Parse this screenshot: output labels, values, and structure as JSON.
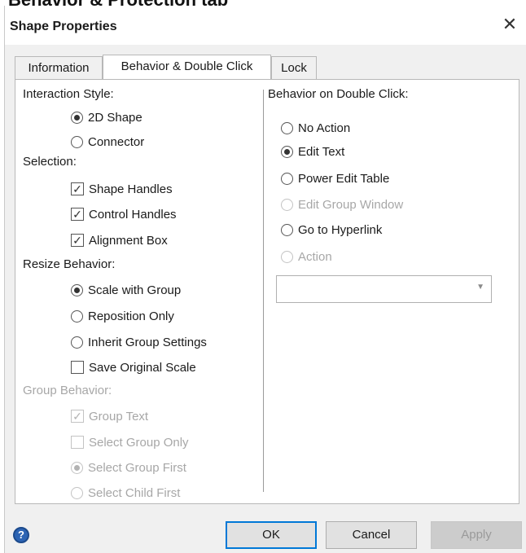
{
  "page_heading": "Behavior & Protection tab",
  "dialog": {
    "title": "Shape Properties",
    "close_glyph": "✕"
  },
  "tabs": [
    {
      "label": "Information",
      "active": false
    },
    {
      "label": "Behavior & Double Click",
      "active": true
    },
    {
      "label": "Lock",
      "active": false
    }
  ],
  "left": {
    "interaction_style": {
      "heading": "Interaction Style:",
      "options": [
        {
          "label": "2D Shape",
          "selected": true
        },
        {
          "label": "Connector",
          "selected": false
        }
      ]
    },
    "selection": {
      "heading": "Selection:",
      "options": [
        {
          "label": "Shape Handles",
          "checked": true
        },
        {
          "label": "Control Handles",
          "checked": true
        },
        {
          "label": "Alignment Box",
          "checked": true
        }
      ]
    },
    "resize_behavior": {
      "heading": "Resize Behavior:",
      "options": [
        {
          "label": "Scale with Group",
          "selected": true
        },
        {
          "label": "Reposition Only",
          "selected": false
        },
        {
          "label": "Inherit Group Settings",
          "selected": false
        }
      ],
      "save_original_scale": {
        "label": "Save Original Scale",
        "checked": false
      }
    },
    "group_behavior": {
      "heading": "Group Behavior:",
      "enabled": false,
      "group_text": {
        "label": "Group Text",
        "checked": true
      },
      "select_group_only": {
        "label": "Select Group Only",
        "checked": false
      },
      "options": [
        {
          "label": "Select Group First",
          "selected": true
        },
        {
          "label": "Select Child First",
          "selected": false
        }
      ]
    }
  },
  "right": {
    "heading": "Behavior on Double Click:",
    "options": [
      {
        "label": "No Action",
        "selected": false,
        "enabled": true
      },
      {
        "label": "Edit Text",
        "selected": true,
        "enabled": true
      },
      {
        "label": "Power Edit Table",
        "selected": false,
        "enabled": true
      },
      {
        "label": "Edit Group Window",
        "selected": false,
        "enabled": false
      },
      {
        "label": "Go to Hyperlink",
        "selected": false,
        "enabled": true
      },
      {
        "label": "Action",
        "selected": false,
        "enabled": false
      }
    ],
    "action_dropdown": {
      "value": "",
      "arrow": "▼"
    }
  },
  "footer": {
    "help_icon": "?",
    "ok": "OK",
    "cancel": "Cancel",
    "apply": "Apply"
  },
  "colors": {
    "accent": "#0078d7",
    "help": "#2c64b4",
    "disabled_text": "#a7a7a7"
  },
  "icons": {
    "close": "close-icon",
    "help": "help-icon",
    "checkmark": "checkmark-icon",
    "dropdown": "chevron-down-icon"
  }
}
